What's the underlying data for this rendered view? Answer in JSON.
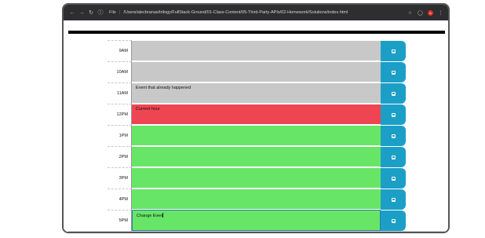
{
  "browser": {
    "file_label": "File",
    "url": "/Users/alecbranas/trilogy/FullStack-Ground/01-Class-Content/05-Third-Party-APIs/02-Homework/Solutions/index.html",
    "ext_badge": "A"
  },
  "colors": {
    "past": "#c8c8c8",
    "present": "#ef4553",
    "future": "#67e566",
    "save": "#1c9fc6"
  },
  "rows": [
    {
      "hour": "9AM",
      "event": "",
      "state": "past"
    },
    {
      "hour": "10AM",
      "event": "",
      "state": "past"
    },
    {
      "hour": "11AM",
      "event": "Event that already happened",
      "state": "past"
    },
    {
      "hour": "12PM",
      "event": "Current hour",
      "state": "present"
    },
    {
      "hour": "1PM",
      "event": "",
      "state": "future"
    },
    {
      "hour": "2PM",
      "event": "",
      "state": "future"
    },
    {
      "hour": "3PM",
      "event": "",
      "state": "future"
    },
    {
      "hour": "4PM",
      "event": "",
      "state": "future"
    },
    {
      "hour": "5PM",
      "event": "Change Even",
      "state": "future"
    }
  ]
}
